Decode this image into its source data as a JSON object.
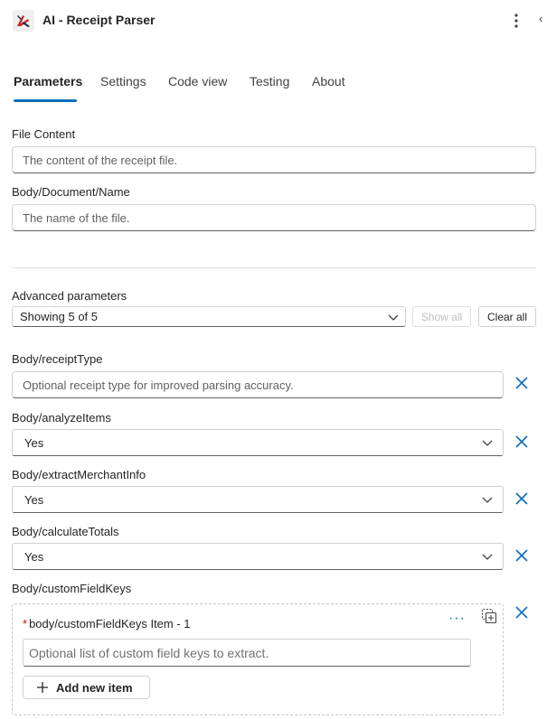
{
  "header": {
    "title": "AI - Receipt Parser",
    "icon": "connector-logo-icon",
    "more_icon": "vertical-ellipsis-icon",
    "collapse_glyph": "‹",
    "accent_color": "#0f6cbd"
  },
  "tabs": [
    {
      "label": "Parameters",
      "active": true
    },
    {
      "label": "Settings",
      "active": false
    },
    {
      "label": "Code view",
      "active": false
    },
    {
      "label": "Testing",
      "active": false
    },
    {
      "label": "About",
      "active": false
    }
  ],
  "fields": {
    "file_content": {
      "label": "File Content",
      "placeholder": "The content of the receipt file."
    },
    "document_name": {
      "label": "Body/Document/Name",
      "placeholder": "The name of the file."
    }
  },
  "advanced": {
    "label": "Advanced parameters",
    "selected": "Showing 5 of 5",
    "show_all": "Show all",
    "clear_all": "Clear all"
  },
  "params": {
    "receipt_type": {
      "label": "Body/receiptType",
      "placeholder": "Optional receipt type for improved parsing accuracy."
    },
    "analyze_items": {
      "label": "Body/analyzeItems",
      "value": "Yes"
    },
    "extract_merchant": {
      "label": "Body/extractMerchantInfo",
      "value": "Yes"
    },
    "calculate_totals": {
      "label": "Body/calculateTotals",
      "value": "Yes"
    },
    "custom_field_keys": {
      "label": "Body/customFieldKeys",
      "required_mark": "*",
      "item_label": "body/customFieldKeys Item - 1",
      "item_more": "···",
      "item_placeholder": "Optional list of custom field keys to extract.",
      "add_label": "Add new item"
    }
  }
}
